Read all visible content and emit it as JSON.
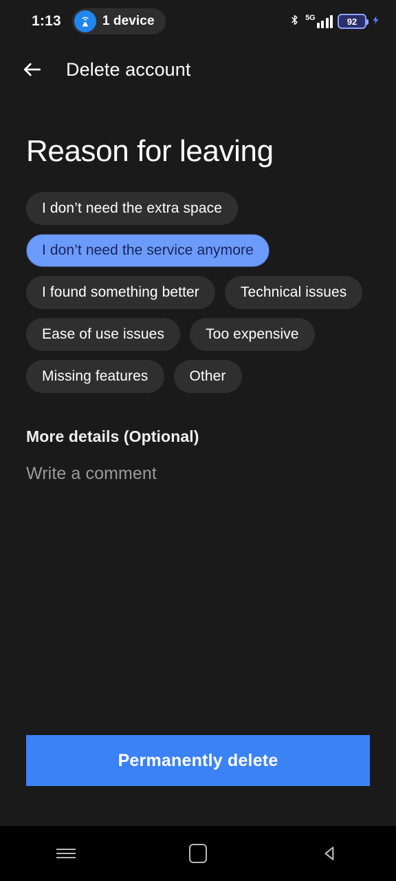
{
  "status_bar": {
    "time": "1:13",
    "hotspot_pill": {
      "icon": "hotspot-icon",
      "label": "1 device",
      "accent": "#2186f0"
    },
    "bluetooth_icon": "bluetooth-icon",
    "network_type": "5G",
    "signal_bars": 4,
    "battery_percent": "92",
    "charging_icon": "charging-bolt-icon"
  },
  "app_bar": {
    "back_icon": "back-arrow-icon",
    "title": "Delete account"
  },
  "main": {
    "page_title": "Reason for leaving",
    "reasons": [
      {
        "label": "I don’t need the extra space",
        "selected": false
      },
      {
        "label": "I don’t need the service anymore",
        "selected": true
      },
      {
        "label": "I found something better",
        "selected": false
      },
      {
        "label": "Technical issues",
        "selected": false
      },
      {
        "label": "Ease of use issues",
        "selected": false
      },
      {
        "label": "Too expensive",
        "selected": false
      },
      {
        "label": "Missing features",
        "selected": false
      },
      {
        "label": "Other",
        "selected": false
      }
    ],
    "details_label": "More details (Optional)",
    "comment_placeholder": "Write a comment",
    "comment_value": ""
  },
  "cta": {
    "delete_label": "Permanently delete",
    "color": "#3b82f6"
  },
  "nav_bar": {
    "recents_icon": "recents-icon",
    "home_icon": "home-square-icon",
    "back_icon": "back-triangle-icon"
  },
  "colors": {
    "background": "#1a1a1a",
    "chip": "#2f2f2f",
    "chip_selected": "#6b9bfb",
    "chip_selected_text": "#1b2355",
    "accent": "#3b82f6"
  }
}
